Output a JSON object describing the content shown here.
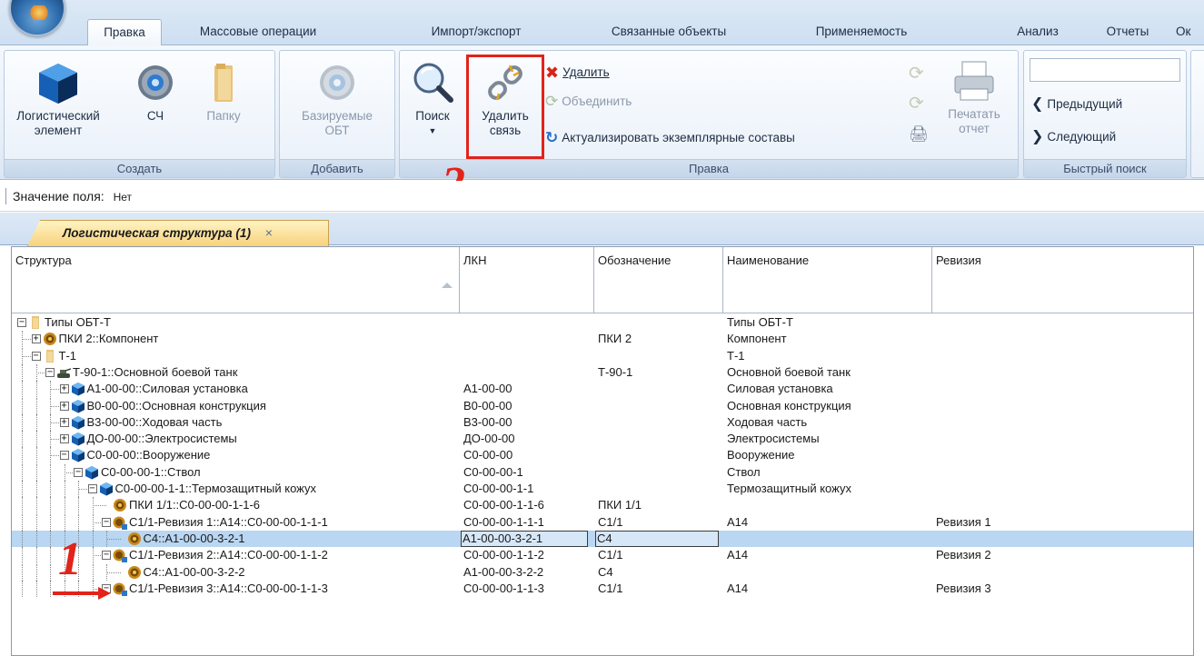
{
  "tabs": [
    {
      "label": "Правка",
      "active": true
    },
    {
      "label": "Массовые операции"
    },
    {
      "label": "Импорт/экспорт"
    },
    {
      "label": "Связанные объекты"
    },
    {
      "label": "Применяемость"
    },
    {
      "label": "Анализ"
    },
    {
      "label": "Отчеты"
    },
    {
      "label": "Ок"
    }
  ],
  "ribbon": {
    "create": {
      "caption": "Создать",
      "logistic_element": "Логистический элемент",
      "logistic_element_l1": "Логистический",
      "logistic_element_l2": "элемент",
      "sch": "СЧ",
      "folder": "Папку"
    },
    "add": {
      "caption": "Добавить",
      "base_obt_l1": "Базируемые",
      "base_obt_l2": "ОБТ"
    },
    "edit": {
      "caption": "Правка",
      "search": "Поиск",
      "delete_link_l1": "Удалить",
      "delete_link_l2": "связь",
      "delete": "Удалить",
      "merge": "Объединить",
      "actualize": "Актуализировать экземплярные составы",
      "print_l1": "Печатать",
      "print_l2": "отчет"
    },
    "quick_search": {
      "caption": "Быстрый поиск",
      "prev": "Предыдущий",
      "next": "Следующий",
      "input_value": ""
    }
  },
  "annotations": {
    "step1": "1",
    "step2": "2"
  },
  "field_bar": {
    "label": "Значение поля:",
    "value": "Нет"
  },
  "doc_tab": {
    "label": "Логистическая структура (1)",
    "close": "×"
  },
  "grid": {
    "columns": [
      "Структура",
      "ЛКН",
      "Обозначение",
      "Наименование",
      "Ревизия"
    ],
    "rows": [
      {
        "label": "Типы ОБТ-Т",
        "lkn": "",
        "obozn": "",
        "name": "Типы ОБТ-Т",
        "rev": "",
        "depth": 0,
        "icon": "folder-icon",
        "exp": "−"
      },
      {
        "label": "ПКИ 2::Компонент",
        "lkn": "",
        "obozn": "ПКИ 2",
        "name": "Компонент",
        "rev": "",
        "depth": 1,
        "icon": "gear-icon",
        "exp": "+"
      },
      {
        "label": "Т-1",
        "lkn": "",
        "obozn": "",
        "name": "Т-1",
        "rev": "",
        "depth": 1,
        "icon": "folder-icon",
        "exp": "−"
      },
      {
        "label": "Т-90-1::Основной боевой танк",
        "lkn": "",
        "obozn": "Т-90-1",
        "name": "Основной боевой танк",
        "rev": "",
        "depth": 2,
        "icon": "tank-icon",
        "exp": "−"
      },
      {
        "label": "А1-00-00::Силовая установка",
        "lkn": "А1-00-00",
        "obozn": "",
        "name": "Силовая установка",
        "rev": "",
        "depth": 3,
        "icon": "cube-icon",
        "exp": "+"
      },
      {
        "label": "В0-00-00::Основная конструкция",
        "lkn": "В0-00-00",
        "obozn": "",
        "name": "Основная конструкция",
        "rev": "",
        "depth": 3,
        "icon": "cube-icon",
        "exp": "+"
      },
      {
        "label": "В3-00-00::Ходовая часть",
        "lkn": "В3-00-00",
        "obozn": "",
        "name": "Ходовая часть",
        "rev": "",
        "depth": 3,
        "icon": "cube-icon",
        "exp": "+"
      },
      {
        "label": "ДО-00-00::Электросистемы",
        "lkn": "ДО-00-00",
        "obozn": "",
        "name": "Электросистемы",
        "rev": "",
        "depth": 3,
        "icon": "cube-icon",
        "exp": "+"
      },
      {
        "label": "С0-00-00::Вооружение",
        "lkn": "С0-00-00",
        "obozn": "",
        "name": "Вооружение",
        "rev": "",
        "depth": 3,
        "icon": "cube-icon",
        "exp": "−"
      },
      {
        "label": "С0-00-00-1::Ствол",
        "lkn": "С0-00-00-1",
        "obozn": "",
        "name": "Ствол",
        "rev": "",
        "depth": 4,
        "icon": "cube-icon",
        "exp": "−"
      },
      {
        "label": "С0-00-00-1-1::Термозащитный кожух",
        "lkn": "С0-00-00-1-1",
        "obozn": "",
        "name": "Термозащитный кожух",
        "rev": "",
        "depth": 5,
        "icon": "cube-icon",
        "exp": "−"
      },
      {
        "label": "ПКИ 1/1::С0-00-00-1-1-6",
        "lkn": "С0-00-00-1-1-6",
        "obozn": "ПКИ 1/1",
        "name": "",
        "rev": "",
        "depth": 6,
        "icon": "gear-icon",
        "exp": ""
      },
      {
        "label": "С1/1-Ревизия 1::А14::С0-00-00-1-1-1",
        "lkn": "С0-00-00-1-1-1",
        "obozn": "С1/1",
        "name": "А14",
        "rev": "Ревизия 1",
        "depth": 6,
        "icon": "gear-link-icon",
        "exp": "−"
      },
      {
        "label": "С4::А1-00-00-3-2-1",
        "lkn": "А1-00-00-3-2-1",
        "obozn": "С4",
        "name": "",
        "rev": "",
        "depth": 7,
        "icon": "gear-icon",
        "exp": "",
        "selected": true
      },
      {
        "label": "С1/1-Ревизия 2::А14::С0-00-00-1-1-2",
        "lkn": "С0-00-00-1-1-2",
        "obozn": "С1/1",
        "name": "А14",
        "rev": "Ревизия 2",
        "depth": 6,
        "icon": "gear-link-icon",
        "exp": "−"
      },
      {
        "label": "С4::А1-00-00-3-2-2",
        "lkn": "А1-00-00-3-2-2",
        "obozn": "С4",
        "name": "",
        "rev": "",
        "depth": 7,
        "icon": "gear-icon",
        "exp": ""
      },
      {
        "label": "С1/1-Ревизия 3::А14::С0-00-00-1-1-3",
        "lkn": "С0-00-00-1-1-3",
        "obozn": "С1/1",
        "name": "А14",
        "rev": "Ревизия 3",
        "depth": 6,
        "icon": "gear-link-icon",
        "exp": "−"
      }
    ]
  }
}
